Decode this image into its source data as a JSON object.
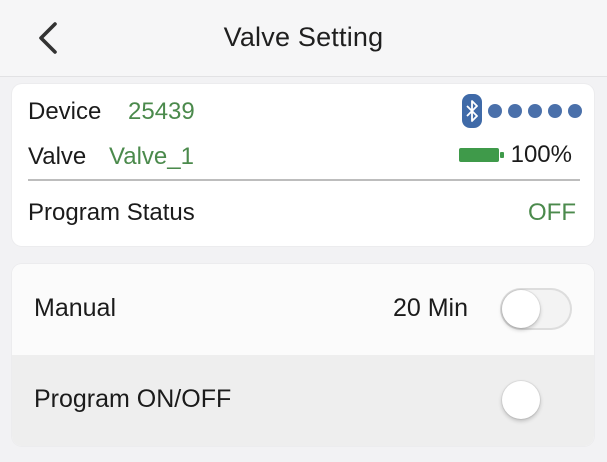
{
  "header": {
    "title": "Valve Setting",
    "back_icon": "chevron-left-icon"
  },
  "device_card": {
    "device_label": "Device",
    "device_value": "25439",
    "valve_label": "Valve",
    "valve_value": "Valve_1",
    "program_status_label": "Program Status",
    "program_status_value": "OFF",
    "bluetooth_icon": "bluetooth-icon",
    "signal_strength_dots": 5,
    "battery_text": "100%",
    "battery_level": 1.0
  },
  "controls": {
    "manual_label": "Manual",
    "manual_duration": "20 Min",
    "manual_toggle_on": false,
    "program_label": "Program ON/OFF",
    "program_toggle_on": false
  },
  "colors": {
    "accent_green": "#4b8a4c",
    "bluetooth_blue": "#3f6aa8",
    "battery_green": "#3f9a4a"
  }
}
